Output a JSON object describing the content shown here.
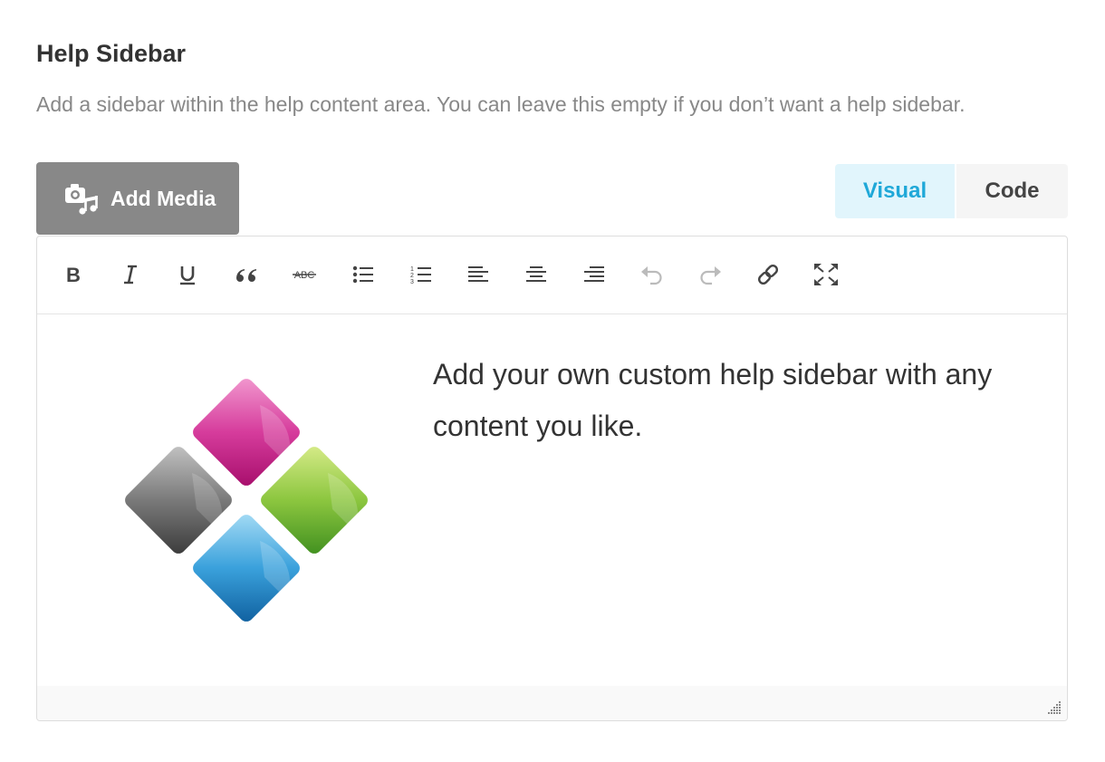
{
  "section": {
    "title": "Help Sidebar",
    "description": "Add a sidebar within the help content area. You can leave this empty if you don’t want a help sidebar."
  },
  "toolbar_top": {
    "add_media_label": "Add Media",
    "tabs": [
      {
        "label": "Visual",
        "active": true
      },
      {
        "label": "Code",
        "active": false
      }
    ]
  },
  "editor_toolbar": [
    "bold-icon",
    "italic-icon",
    "underline-icon",
    "blockquote-icon",
    "strikethrough-icon",
    "bullet-list-icon",
    "numbered-list-icon",
    "align-left-icon",
    "align-center-icon",
    "align-right-icon",
    "undo-icon",
    "redo-icon",
    "link-icon",
    "fullscreen-icon"
  ],
  "editor_content": {
    "text": "Add your own custom help sidebar with any content you like.",
    "image": "four-colored-diamonds-logo"
  },
  "colors": {
    "accent": "#1fa8d8",
    "button_bg": "#888888",
    "magenta": "#c2187f",
    "green": "#5cab28",
    "gray": "#555555",
    "blue": "#1e88c8"
  }
}
